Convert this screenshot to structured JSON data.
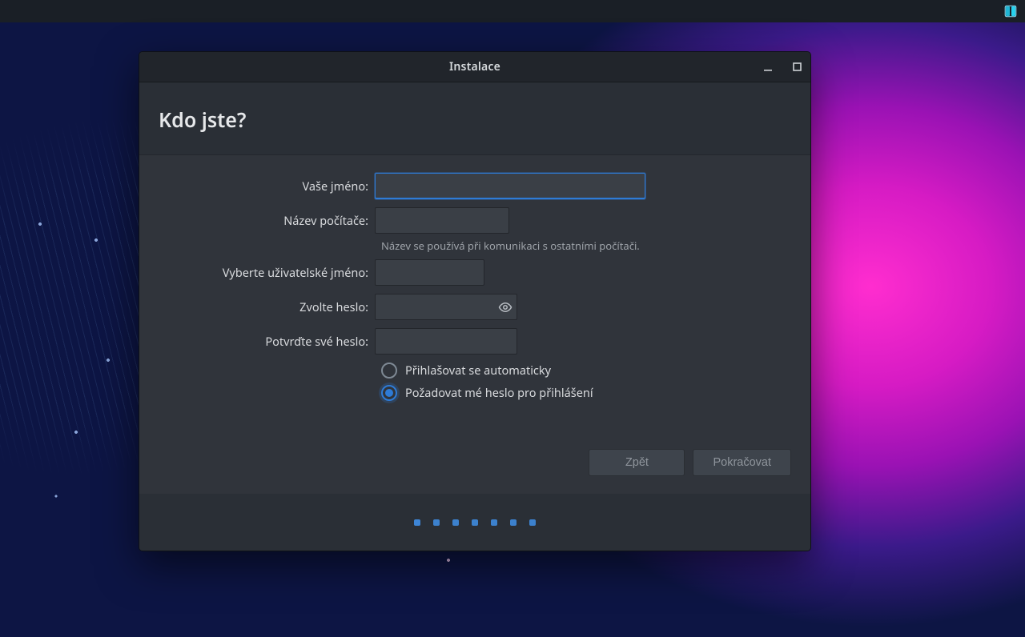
{
  "panel": {
    "tray_icon": "installer-indicator-icon"
  },
  "window": {
    "title": "Instalace"
  },
  "page": {
    "heading": "Kdo jste?"
  },
  "form": {
    "labels": {
      "name": "Vaše jméno:",
      "hostname": "Název počítače:",
      "username": "Vyberte uživatelské jméno:",
      "password": "Zvolte heslo:",
      "confirm": "Potvrďte své heslo:"
    },
    "values": {
      "name": "",
      "hostname": "",
      "username": "",
      "password": "",
      "confirm": ""
    },
    "hints": {
      "hostname": "Název se používá při komunikaci s ostatními počítači."
    },
    "login": {
      "auto": "Přihlašovat se automaticky",
      "require_pw": "Požadovat mé heslo pro přihlášení",
      "selected": "require_pw"
    }
  },
  "buttons": {
    "back": "Zpět",
    "continue": "Pokračovat"
  },
  "progress": {
    "steps": 7,
    "current": 1
  },
  "colors": {
    "accent": "#2e7bd6",
    "window_bg": "#2a2f36",
    "panel_bg": "#30343b",
    "input_bg": "#3a3f46",
    "text": "#d8dadd",
    "muted": "#9ea3a9"
  }
}
